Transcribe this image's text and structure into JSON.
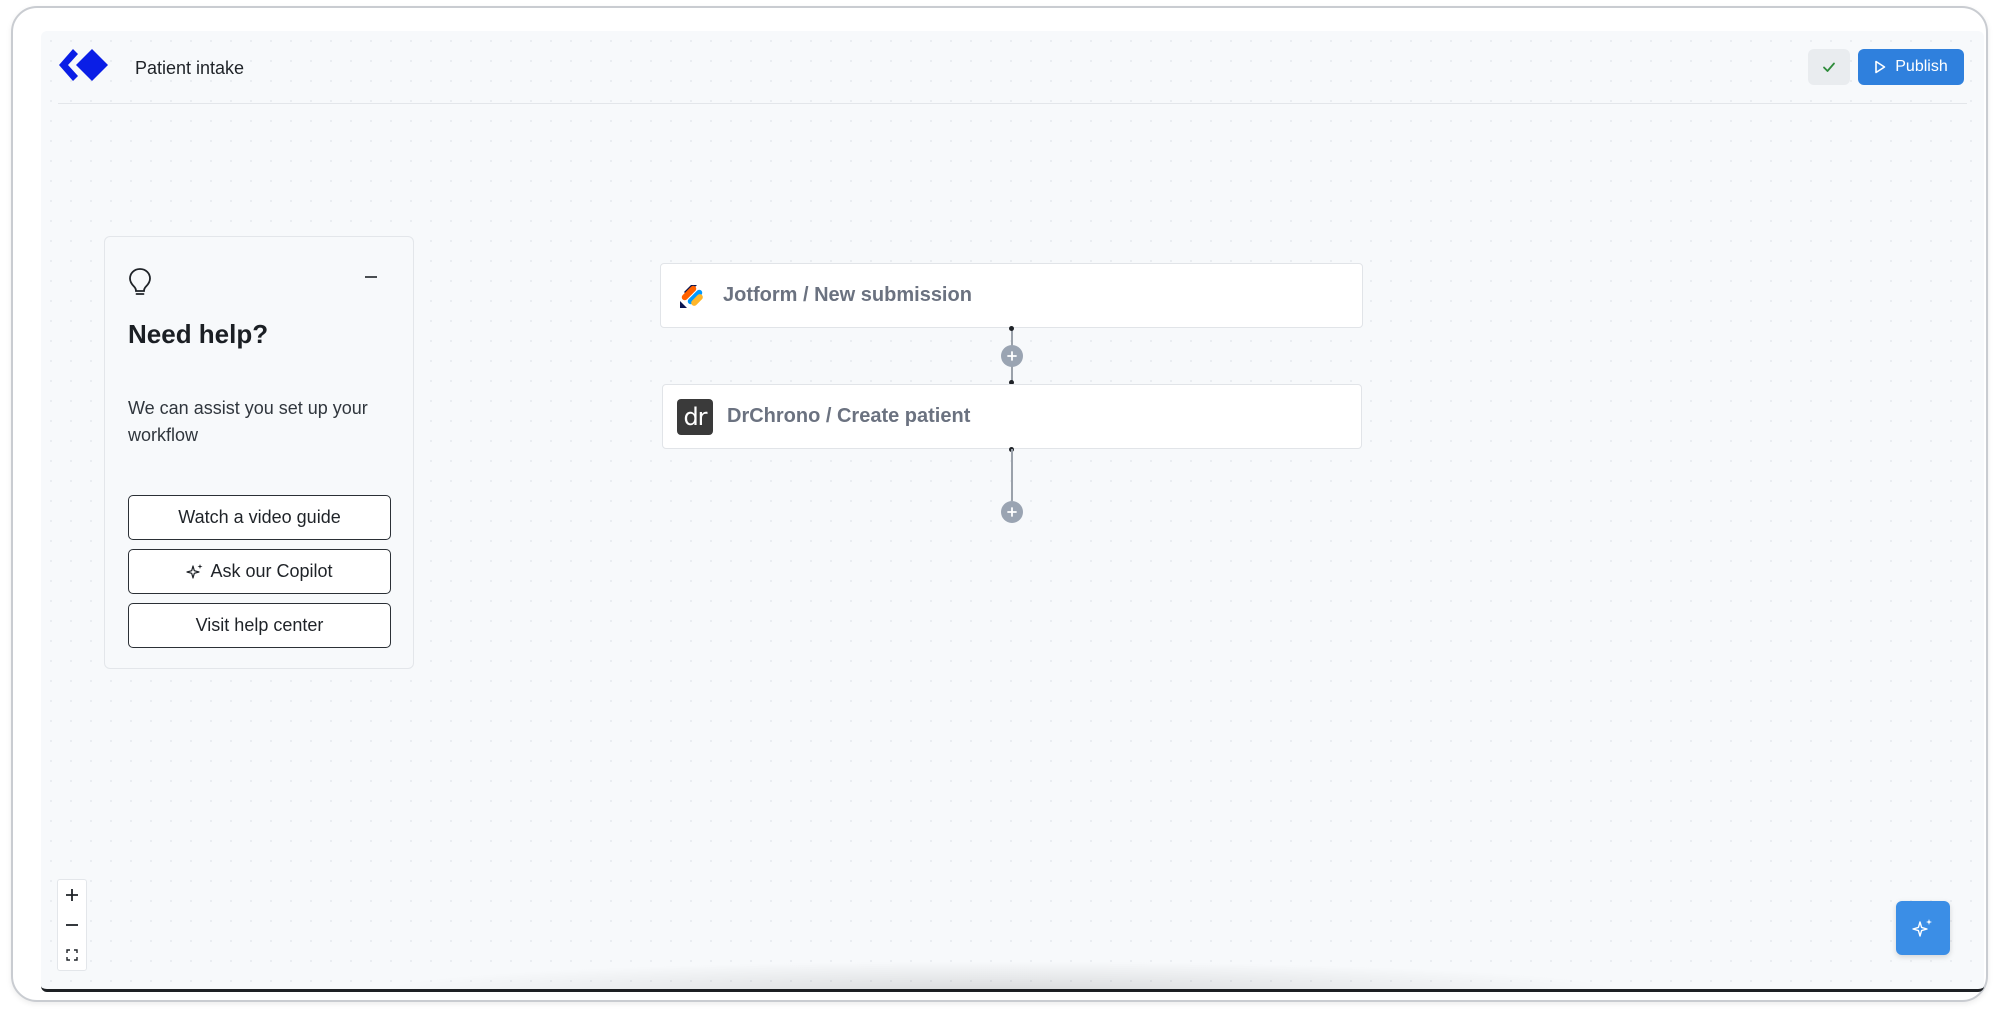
{
  "header": {
    "logo_icon": "diamond-chevron-logo-icon",
    "title": "Patient intake",
    "check_icon": "checkmark-icon",
    "publish_label": "Publish",
    "publish_icon": "play-icon",
    "brand_color": "#0a1ee6",
    "publish_color": "#2f80dd"
  },
  "help_card": {
    "icon": "lightbulb-icon",
    "minimize_icon": "minus-icon",
    "title": "Need help?",
    "text": "We can assist you set up your workflow",
    "buttons": [
      {
        "label": "Watch a video guide"
      },
      {
        "label": "Ask our Copilot",
        "icon": "sparkles-icon"
      },
      {
        "label": "Visit help center"
      }
    ]
  },
  "workflow": {
    "nodes": [
      {
        "label": "Jotform / New submission",
        "icon": "jotform-logo-icon"
      },
      {
        "label": "DrChrono / Create patient",
        "icon": "drchrono-logo-icon",
        "icon_text": "dr"
      }
    ],
    "add_step_icon": "plus-circle-icon"
  },
  "zoom_controls": {
    "zoom_in_icon": "plus-icon",
    "zoom_out_icon": "minus-icon",
    "fit_icon": "fit-view-icon"
  },
  "copilot_fab": {
    "icon": "sparkles-icon",
    "color": "#3b8ee6"
  }
}
